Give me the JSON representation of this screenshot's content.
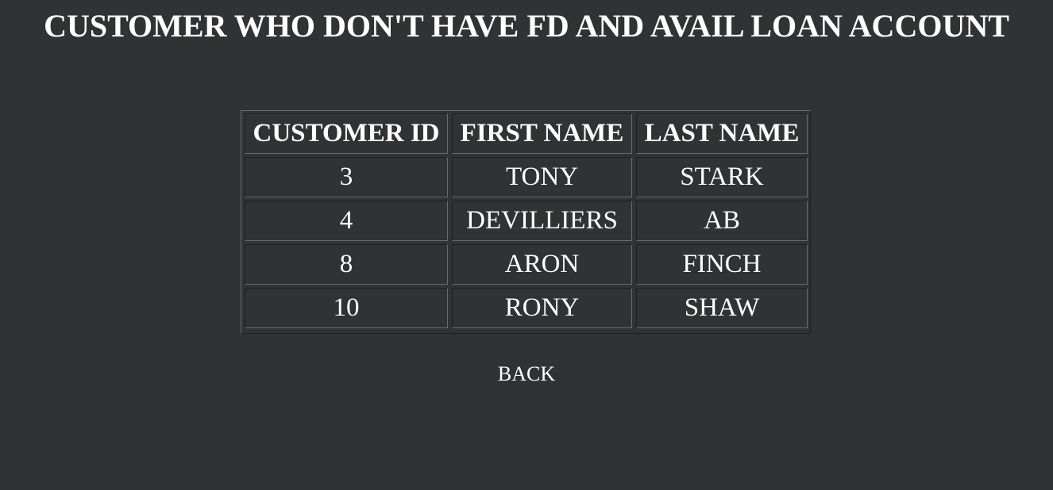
{
  "page": {
    "title": "CUSTOMER WHO DON'T HAVE FD AND AVAIL LOAN ACCOUNT"
  },
  "table": {
    "headers": [
      "CUSTOMER ID",
      "FIRST NAME",
      "LAST NAME"
    ],
    "rows": [
      [
        "3",
        "TONY",
        "STARK"
      ],
      [
        "4",
        "DEVILLIERS",
        "AB"
      ],
      [
        "8",
        "ARON",
        "FINCH"
      ],
      [
        "10",
        "RONY",
        "SHAW"
      ]
    ]
  },
  "nav": {
    "back_label": "BACK"
  },
  "colors": {
    "background": "#313234",
    "text": "#ffffff"
  }
}
